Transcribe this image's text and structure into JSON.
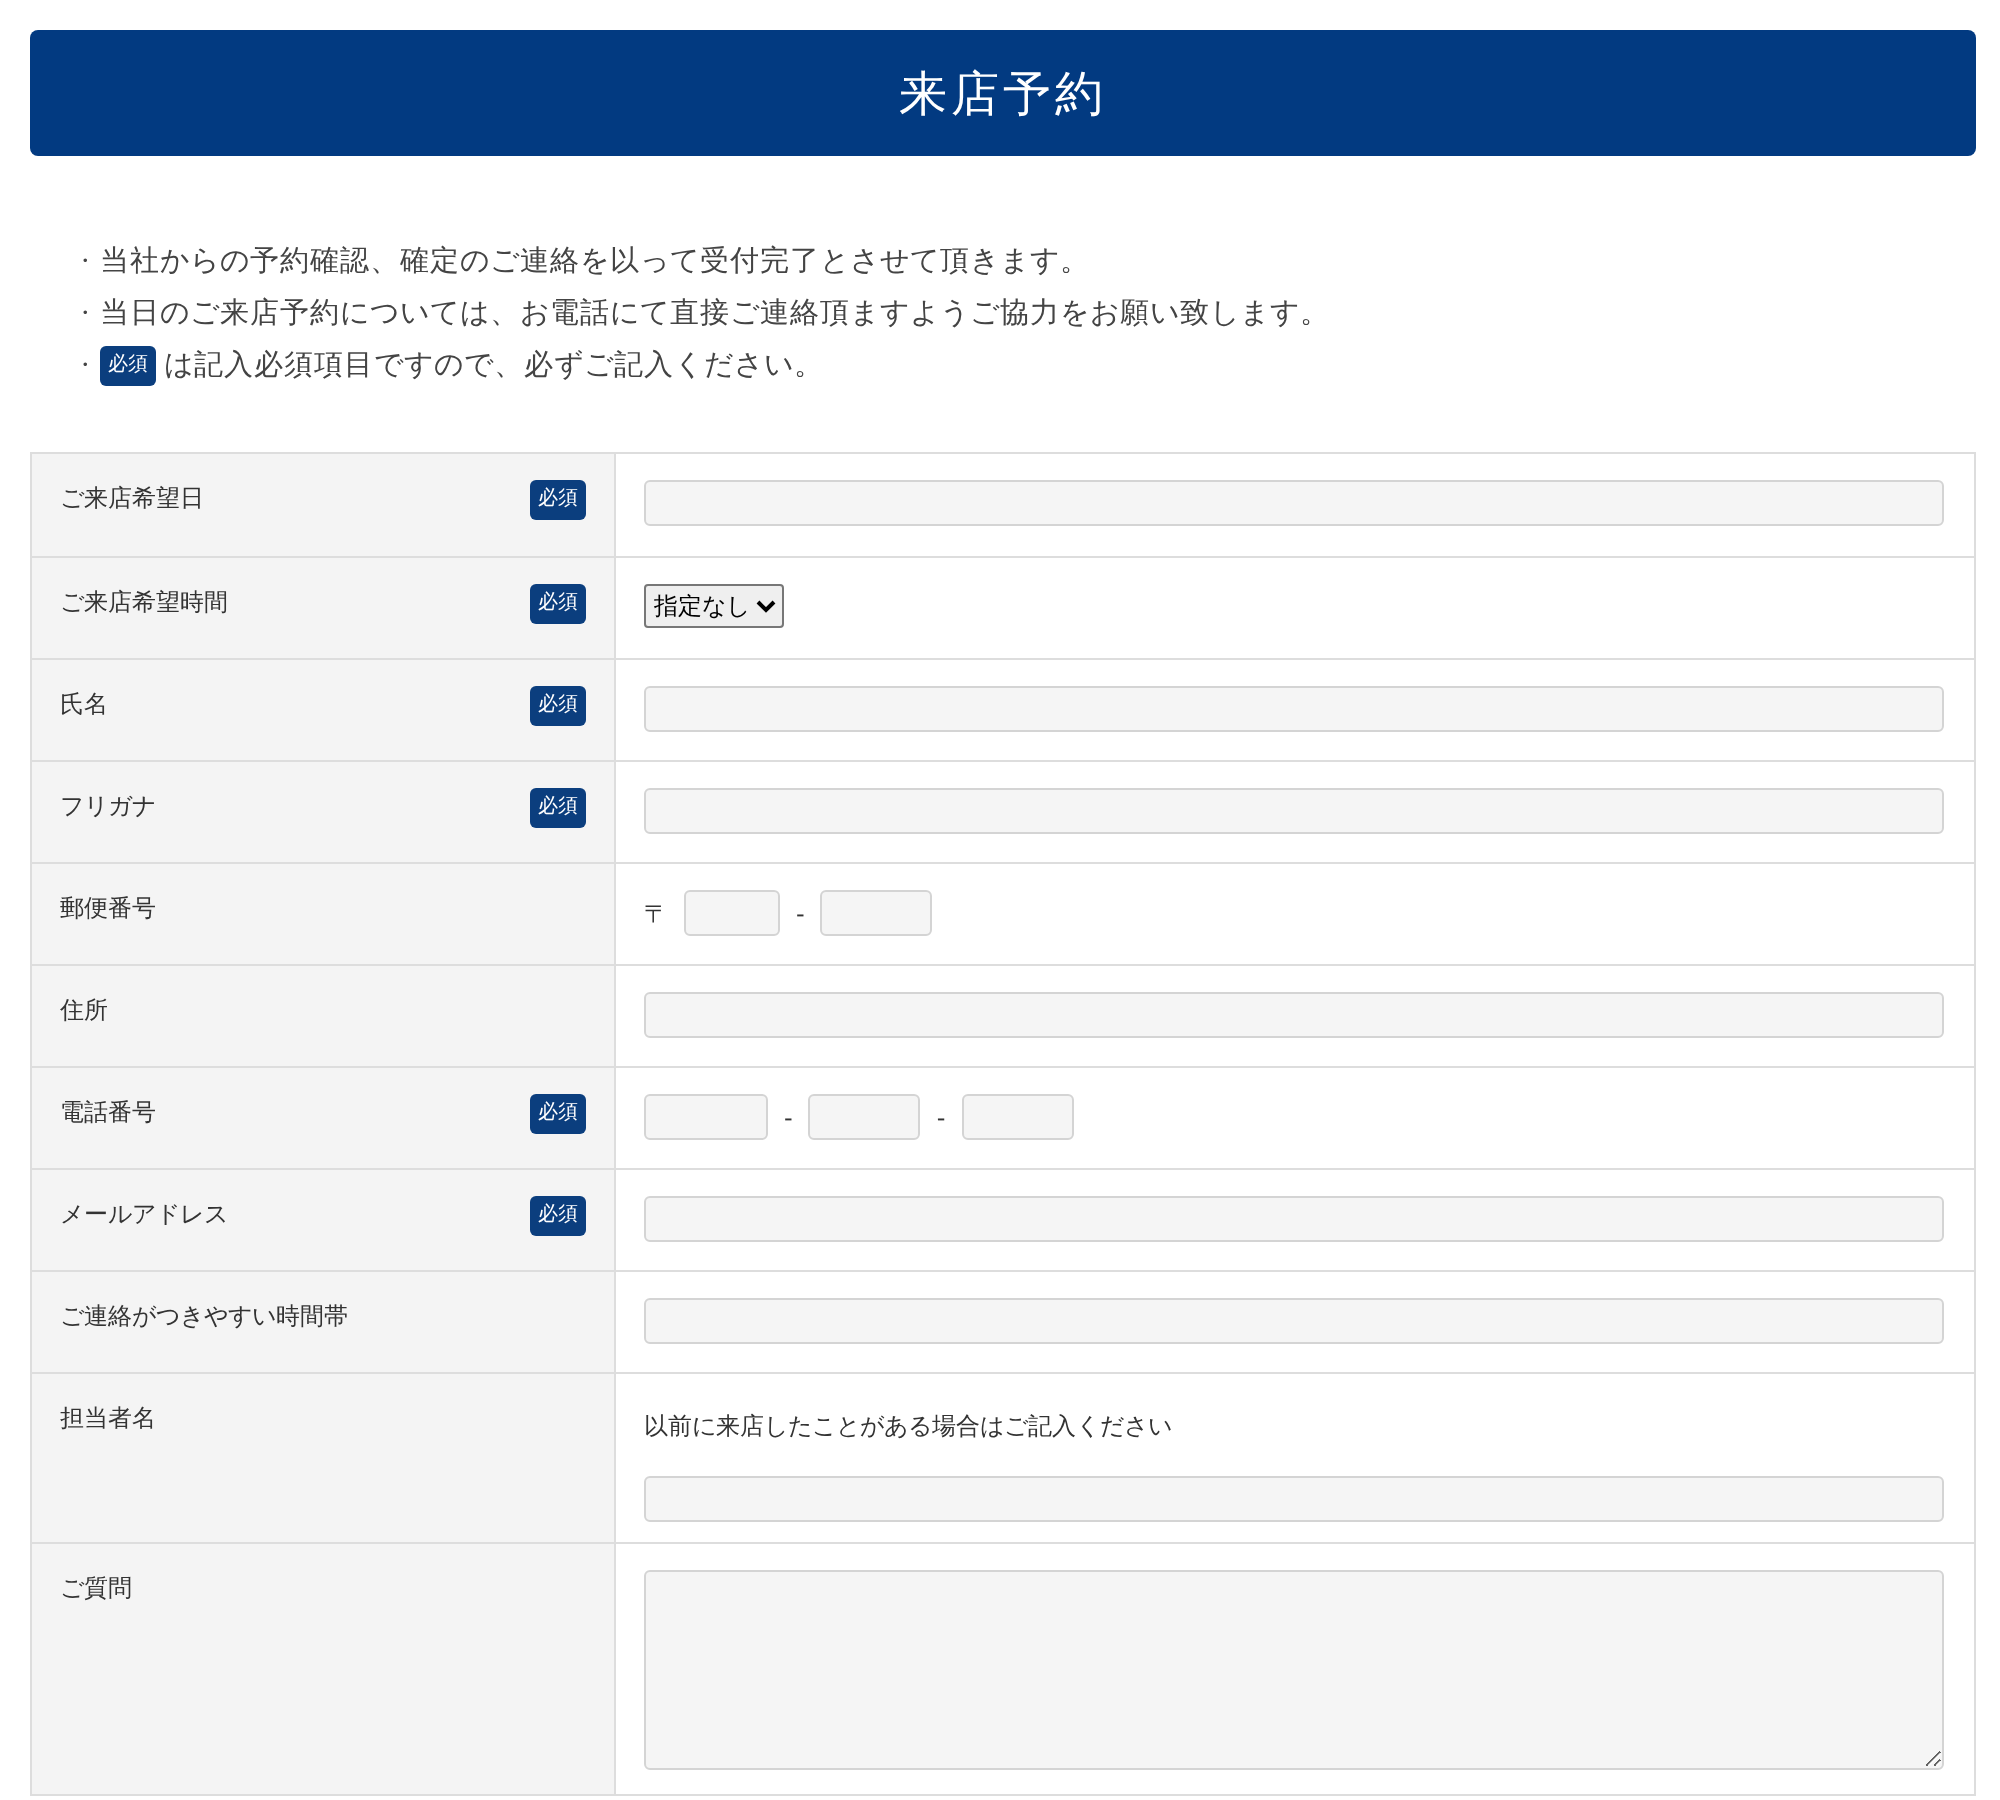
{
  "header": {
    "title": "来店予約"
  },
  "notes": [
    {
      "bullet": "・",
      "text": "当社からの予約確認、確定のご連絡を以って受付完了とさせて頂きます。"
    },
    {
      "bullet": "・",
      "text": "当日のご来店予約については、お電話にて直接ご連絡頂ますようご協力をお願い致します。"
    },
    {
      "bullet": "・",
      "badge": "必須",
      "text": "は記入必須項目ですので、必ずご記入ください。"
    }
  ],
  "form": {
    "rows": [
      {
        "label": "ご来店希望日",
        "badge": "必須",
        "kind": "text"
      },
      {
        "label": "ご来店希望時間",
        "badge": "必須",
        "kind": "select",
        "value": "指定なし"
      },
      {
        "label": "氏名",
        "badge": "必須",
        "kind": "text"
      },
      {
        "label": "フリガナ",
        "badge": "必須",
        "kind": "text"
      },
      {
        "label": "郵便番号",
        "kind": "zip",
        "prefix": "〒",
        "separators": [
          "-"
        ]
      },
      {
        "label": "住所",
        "kind": "text"
      },
      {
        "label": "電話番号",
        "badge": "必須",
        "kind": "tel",
        "separators": [
          "-",
          "-"
        ]
      },
      {
        "label": "メールアドレス",
        "badge": "必須",
        "kind": "text"
      },
      {
        "label": "ご連絡がつきやすい時間帯",
        "kind": "text"
      },
      {
        "label": "担当者名",
        "kind": "text",
        "note": "以前に来店したことがある場合はご記入ください"
      },
      {
        "label": "ご質問",
        "kind": "textarea"
      }
    ]
  }
}
